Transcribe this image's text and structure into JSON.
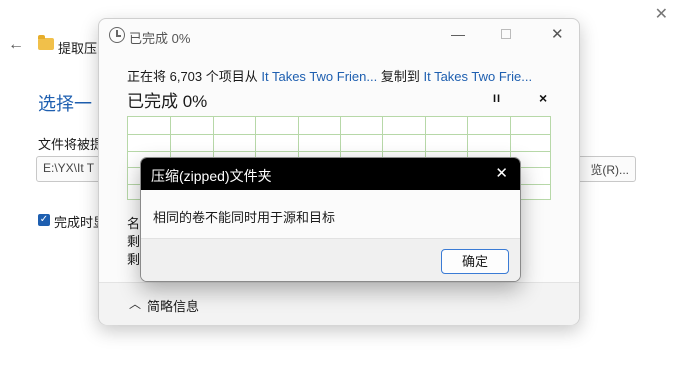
{
  "background_window": {
    "title_fragment": "提取压",
    "heading_fragment": "选择一",
    "label_fragment": "文件将被提",
    "path_fragment": "E:\\YX\\It T",
    "browse_fragment": "览(R)...",
    "checkbox_label_fragment": "完成时显"
  },
  "progress_window": {
    "title": "已完成 0%",
    "status": {
      "prefix": "正在将 6,703 个项目从 ",
      "source": "It Takes Two Frien...",
      "middle": " 复制到 ",
      "destination": "It Takes Two Frie..."
    },
    "percent": "已完成 0%",
    "pause_glyph": "II",
    "stop_glyph": "×",
    "detail_fragments": [
      "名",
      "剩",
      "剩"
    ],
    "footer_label": "简略信息",
    "progress_fraction": 0
  },
  "dialog": {
    "title": "压缩(zipped)文件夹",
    "message": "相同的卷不能同时用于源和目标",
    "ok_label": "确定"
  },
  "colors": {
    "accent": "#1e5fb0",
    "graph_grid": "#b7d8a8",
    "dialog_title_bg": "#000000"
  }
}
